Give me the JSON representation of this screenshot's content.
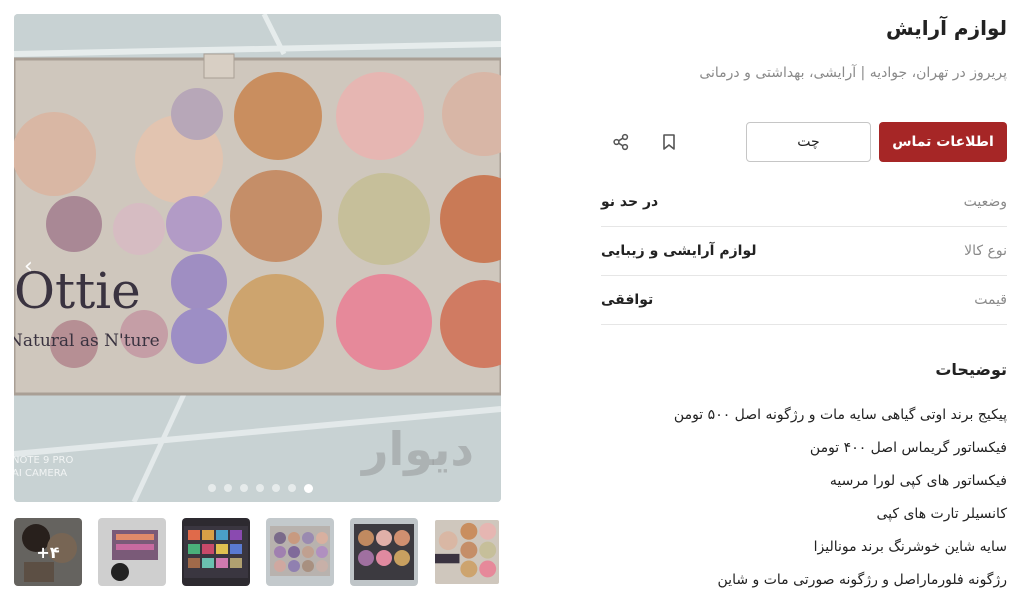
{
  "listing": {
    "title": "لوازم آرایش",
    "subtitle": "پریروز در تهران، جوادیه | آرایشی، بهداشتی و درمانی"
  },
  "actions": {
    "contact_label": "اطلاعات تماس",
    "chat_label": "چت",
    "bookmark_icon": "bookmark-icon",
    "share_icon": "share-icon"
  },
  "attributes": [
    {
      "key": "وضعیت",
      "value": "در حد نو"
    },
    {
      "key": "نوع کالا",
      "value": "لوازم آرایشی و زیبایی"
    },
    {
      "key": "قیمت",
      "value": "توافقی"
    }
  ],
  "description": {
    "heading": "توضیحات",
    "lines": [
      "پیکیج برند اوتی گیاهی سایه مات و رژگونه اصل ۵۰۰ تومن",
      "فیکساتور گریماس اصل ۴۰۰ تومن",
      "فیکساتور های کپی لورا مرسیه",
      "کانسیلر تارت های کپی",
      "سایه شاین خوشرنگ برند مونالیزا",
      "رژگونه فلورماراصل و رژگونه صورتی مات و شاین"
    ]
  },
  "gallery": {
    "brand_text_line1": "Ottie",
    "brand_text_line2": "Natural as N'ture",
    "camera_line1": "NOTE 9 PRO",
    "camera_line2": "AI CAMERA",
    "watermark": "دیوار",
    "dots_count": 7,
    "active_dot": 7,
    "prev_arrow": "‹",
    "more_label": "+۴"
  },
  "colors": {
    "accent": "#a62626",
    "muted": "#8a8a8a"
  }
}
